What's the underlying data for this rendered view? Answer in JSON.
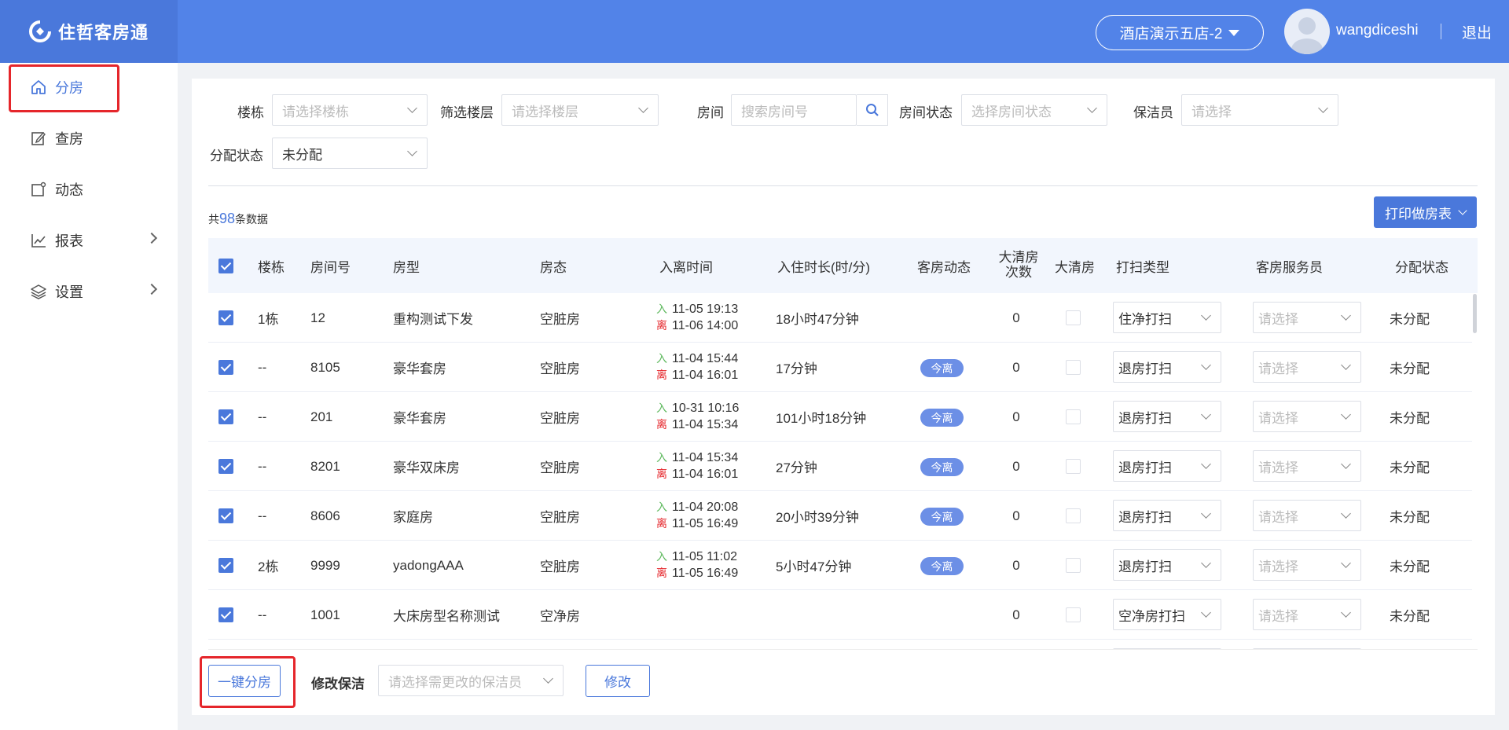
{
  "header": {
    "app_name": "住哲客房通",
    "hotel": "酒店演示五店-2",
    "username": "wangdiceshi",
    "logout": "退出"
  },
  "sidebar": {
    "items": [
      {
        "label": "分房",
        "icon": "home-icon",
        "active": true
      },
      {
        "label": "查房",
        "icon": "edit-icon"
      },
      {
        "label": "动态",
        "icon": "activity-icon"
      },
      {
        "label": "报表",
        "icon": "chart-icon",
        "expandable": true
      },
      {
        "label": "设置",
        "icon": "layers-icon",
        "expandable": true
      }
    ]
  },
  "filters": {
    "building_label": "楼栋",
    "building_ph": "请选择楼栋",
    "floor_label": "筛选楼层",
    "floor_ph": "请选择楼层",
    "room_label": "房间",
    "room_ph": "搜索房间号",
    "status_label": "房间状态",
    "status_ph": "选择房间状态",
    "cleaner_label": "保洁员",
    "cleaner_ph": "请选择",
    "assign_label": "分配状态",
    "assign_value": "未分配"
  },
  "summary": {
    "prefix": "共",
    "count": "98",
    "suffix": "条数据"
  },
  "print_button": "打印做房表",
  "table": {
    "headers": [
      "楼栋",
      "房间号",
      "房型",
      "房态",
      "入离时间",
      "入住时长(时/分)",
      "客房动态",
      "大清房次数",
      "大清房",
      "打扫类型",
      "客房服务员",
      "分配状态"
    ],
    "header_count_line1": "大清房",
    "header_count_line2": "次数",
    "in_mark": "入",
    "out_mark": "离",
    "rows": [
      {
        "building": "1栋",
        "room": "12",
        "type": "重构测试下发",
        "status": "空脏房",
        "in": "11-05 19:13",
        "out": "11-06 14:00",
        "duration": "18小时47分钟",
        "dynamic": "",
        "count": "0",
        "clean_type": "住净打扫",
        "servant_ph": "请选择",
        "assign": "未分配"
      },
      {
        "building": "--",
        "room": "8105",
        "type": "豪华套房",
        "status": "空脏房",
        "in": "11-04 15:44",
        "out": "11-04 16:01",
        "duration": "17分钟",
        "dynamic": "今离",
        "count": "0",
        "clean_type": "退房打扫",
        "servant_ph": "请选择",
        "assign": "未分配"
      },
      {
        "building": "--",
        "room": "201",
        "type": "豪华套房",
        "status": "空脏房",
        "in": "10-31 10:16",
        "out": "11-04 15:34",
        "duration": "101小时18分钟",
        "dynamic": "今离",
        "count": "0",
        "clean_type": "退房打扫",
        "servant_ph": "请选择",
        "assign": "未分配"
      },
      {
        "building": "--",
        "room": "8201",
        "type": "豪华双床房",
        "status": "空脏房",
        "in": "11-04 15:34",
        "out": "11-04 16:01",
        "duration": "27分钟",
        "dynamic": "今离",
        "count": "0",
        "clean_type": "退房打扫",
        "servant_ph": "请选择",
        "assign": "未分配"
      },
      {
        "building": "--",
        "room": "8606",
        "type": "家庭房",
        "status": "空脏房",
        "in": "11-04 20:08",
        "out": "11-05 16:49",
        "duration": "20小时39分钟",
        "dynamic": "今离",
        "count": "0",
        "clean_type": "退房打扫",
        "servant_ph": "请选择",
        "assign": "未分配"
      },
      {
        "building": "2栋",
        "room": "9999",
        "type": "yadongAAA",
        "status": "空脏房",
        "in": "11-05 11:02",
        "out": "11-05 16:49",
        "duration": "5小时47分钟",
        "dynamic": "今离",
        "count": "0",
        "clean_type": "退房打扫",
        "servant_ph": "请选择",
        "assign": "未分配"
      },
      {
        "building": "--",
        "room": "1001",
        "type": "大床房型名称测试",
        "status": "空净房",
        "in": "",
        "out": "",
        "duration": "",
        "dynamic": "",
        "count": "0",
        "clean_type": "空净房打扫",
        "servant_ph": "请选择",
        "assign": "未分配"
      }
    ]
  },
  "footer": {
    "one_click": "一键分房",
    "modify_label": "修改保洁",
    "modify_ph": "请选择需更改的保洁员",
    "modify_btn": "修改"
  },
  "colors": {
    "primary": "#4a78db",
    "header": "#5283e8",
    "highlight": "#e5262b"
  }
}
